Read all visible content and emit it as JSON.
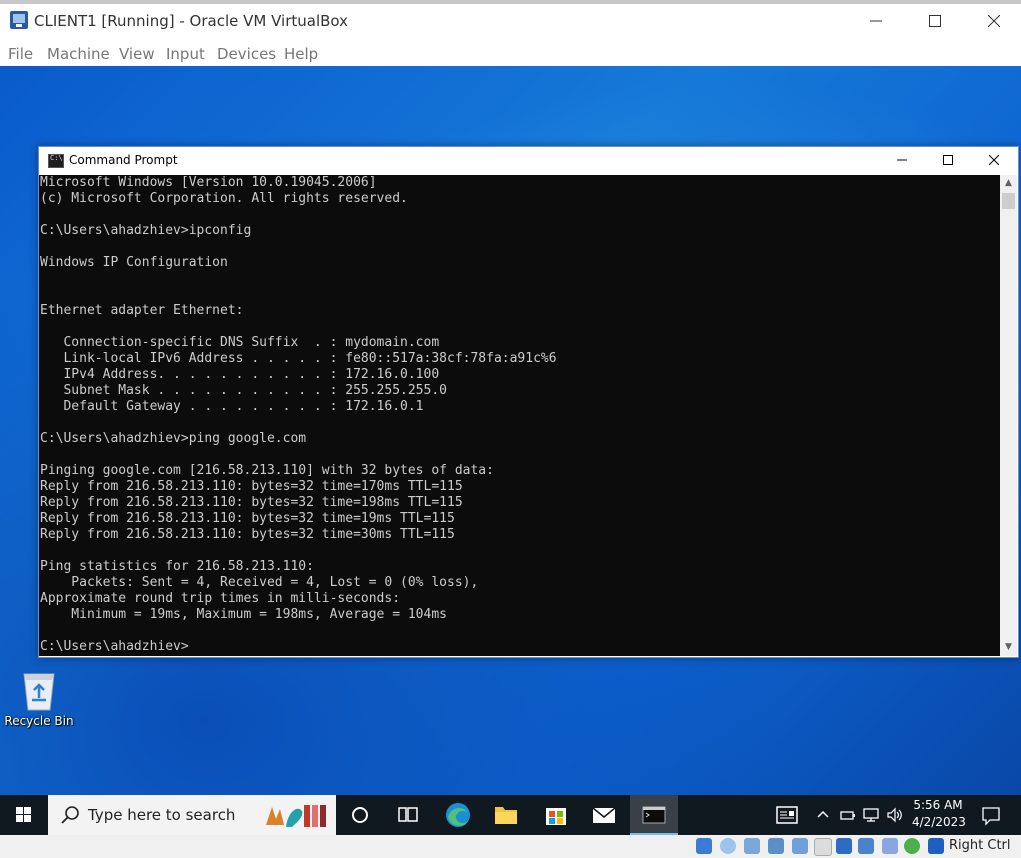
{
  "vbox": {
    "title": "CLIENT1 [Running] - Oracle VM VirtualBox",
    "menu": [
      "File",
      "Machine",
      "View",
      "Input",
      "Devices",
      "Help"
    ],
    "host_key": "Right Ctrl"
  },
  "cmd": {
    "title": "Command Prompt",
    "lines": [
      "Microsoft Windows [Version 10.0.19045.2006]",
      "(c) Microsoft Corporation. All rights reserved.",
      "",
      "C:\\Users\\ahadzhiev>ipconfig",
      "",
      "Windows IP Configuration",
      "",
      "",
      "Ethernet adapter Ethernet:",
      "",
      "   Connection-specific DNS Suffix  . : mydomain.com",
      "   Link-local IPv6 Address . . . . . : fe80::517a:38cf:78fa:a91c%6",
      "   IPv4 Address. . . . . . . . . . . : 172.16.0.100",
      "   Subnet Mask . . . . . . . . . . . : 255.255.255.0",
      "   Default Gateway . . . . . . . . . : 172.16.0.1",
      "",
      "C:\\Users\\ahadzhiev>ping google.com",
      "",
      "Pinging google.com [216.58.213.110] with 32 bytes of data:",
      "Reply from 216.58.213.110: bytes=32 time=170ms TTL=115",
      "Reply from 216.58.213.110: bytes=32 time=198ms TTL=115",
      "Reply from 216.58.213.110: bytes=32 time=19ms TTL=115",
      "Reply from 216.58.213.110: bytes=32 time=30ms TTL=115",
      "",
      "Ping statistics for 216.58.213.110:",
      "    Packets: Sent = 4, Received = 4, Lost = 0 (0% loss),",
      "Approximate round trip times in milli-seconds:",
      "    Minimum = 19ms, Maximum = 198ms, Average = 104ms",
      "",
      "C:\\Users\\ahadzhiev>"
    ]
  },
  "desktop": {
    "recycle_bin_label": "Recycle Bin"
  },
  "taskbar": {
    "search_placeholder": "Type here to search",
    "time": "5:56 AM",
    "date": "4/2/2023"
  },
  "colors": {
    "console_bg": "#0c0c0c",
    "console_fg": "#cccccc",
    "taskbar_bg": "#101820",
    "desktop_blue": "#0a5bcc"
  }
}
